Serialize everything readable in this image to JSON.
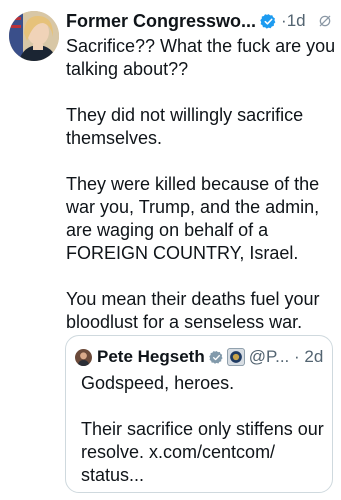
{
  "tweet": {
    "author_name": "Former Congresswo...",
    "time": "·1d",
    "more_icon": "···",
    "paragraphs": [
      "Sacrifice?? What the fuck are you talking about??",
      "They did not willingly sacrifice themselves.",
      "They were killed because of the war you, Trump, and the admin, are waging on behalf of a FOREIGN COUNTRY, Israel.",
      "You mean their deaths fuel your bloodlust for a senseless war."
    ]
  },
  "quoted": {
    "author_name": "Pete Hegseth",
    "handle_time": "@P... · 2d",
    "paragraphs": [
      "Godspeed, heroes.",
      "Their sacrifice only stiffens our resolve. x.com/centcom/ status..."
    ]
  },
  "colors": {
    "verified_blue": "#1d9bf0",
    "secondary_text": "#536471",
    "border": "#cfd9de"
  }
}
